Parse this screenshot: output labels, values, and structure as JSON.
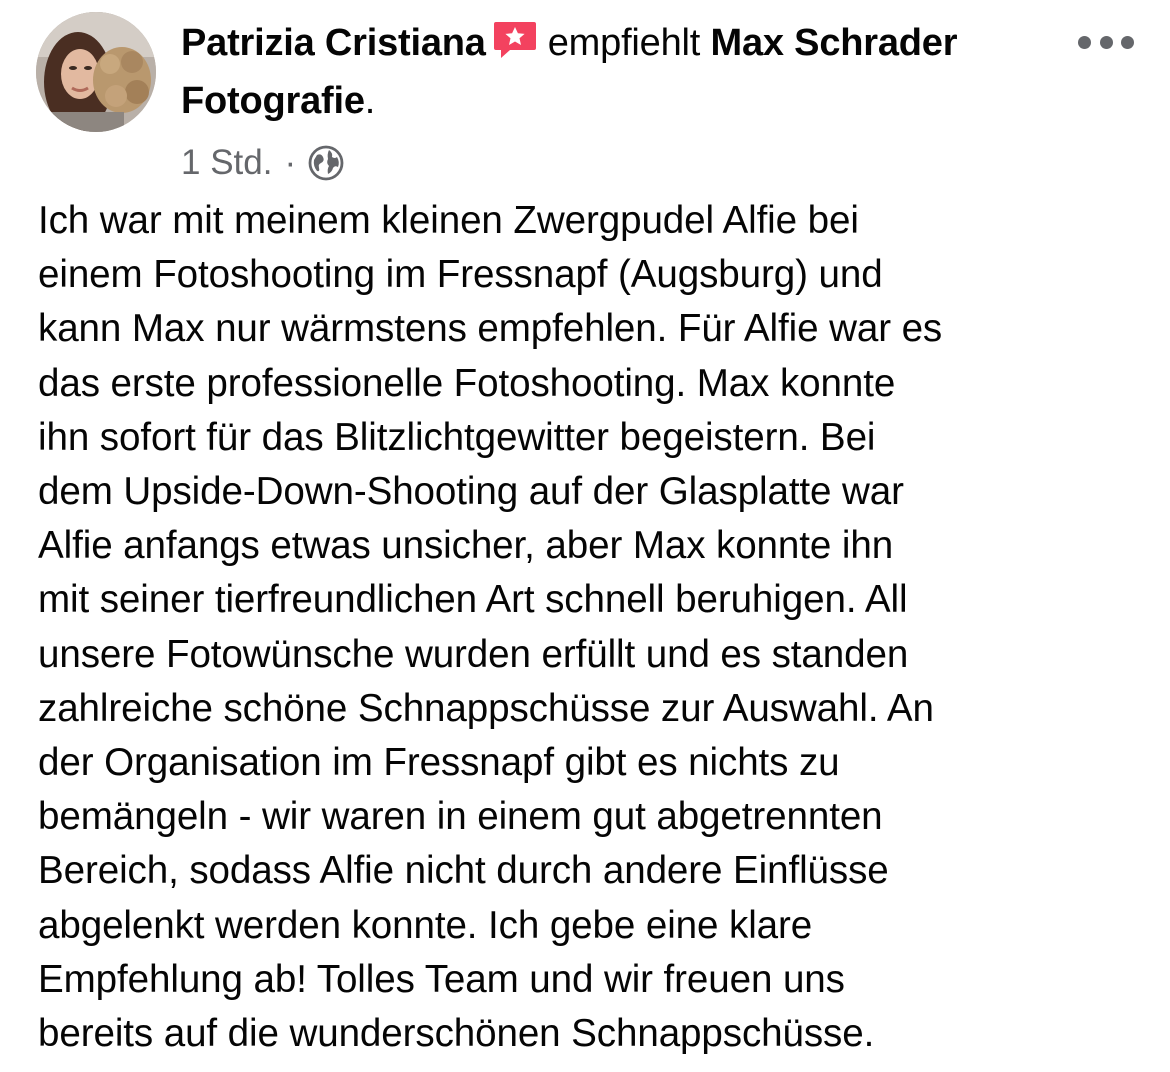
{
  "header": {
    "author_name": "Patrizia Cristiana",
    "action_text": "empfiehlt",
    "page_name": "Max Schrader Fotografie",
    "page_name_suffix": ".",
    "more_icon": "more-horizontal-icon",
    "badge_icon": "recommendation-star-icon"
  },
  "meta": {
    "timestamp": "1 Std.",
    "separator": "·",
    "privacy_icon": "globe-icon"
  },
  "post": {
    "lines": [
      "Ich war mit meinem kleinen Zwergpudel Alfie bei",
      "einem Fotoshooting im Fressnapf (Augsburg) und",
      "kann Max nur wärmstens empfehlen. Für Alfie war es",
      "das erste professionelle Fotoshooting. Max konnte",
      "ihn sofort für das Blitzlichtgewitter begeistern. Bei",
      "dem Upside-Down-Shooting auf der Glasplatte war",
      "Alfie anfangs etwas unsicher, aber Max konnte ihn",
      "mit seiner tierfreundlichen Art schnell beruhigen. All",
      "unsere Fotowünsche wurden erfüllt und es standen",
      "zahlreiche schöne Schnappschüsse zur Auswahl. An",
      "der Organisation im Fressnapf gibt es nichts zu",
      "bemängeln - wir waren in einem gut abgetrennten",
      "Bereich, sodass Alfie nicht durch andere Einflüsse",
      "abgelenkt werden konnte. Ich gebe eine klare",
      "Empfehlung ab! Tolles Team und wir freuen uns",
      "bereits auf die wunderschönen Schnappschüsse."
    ]
  },
  "colors": {
    "text": "#050505",
    "secondary": "#65676b",
    "badge": "#f3425f"
  }
}
